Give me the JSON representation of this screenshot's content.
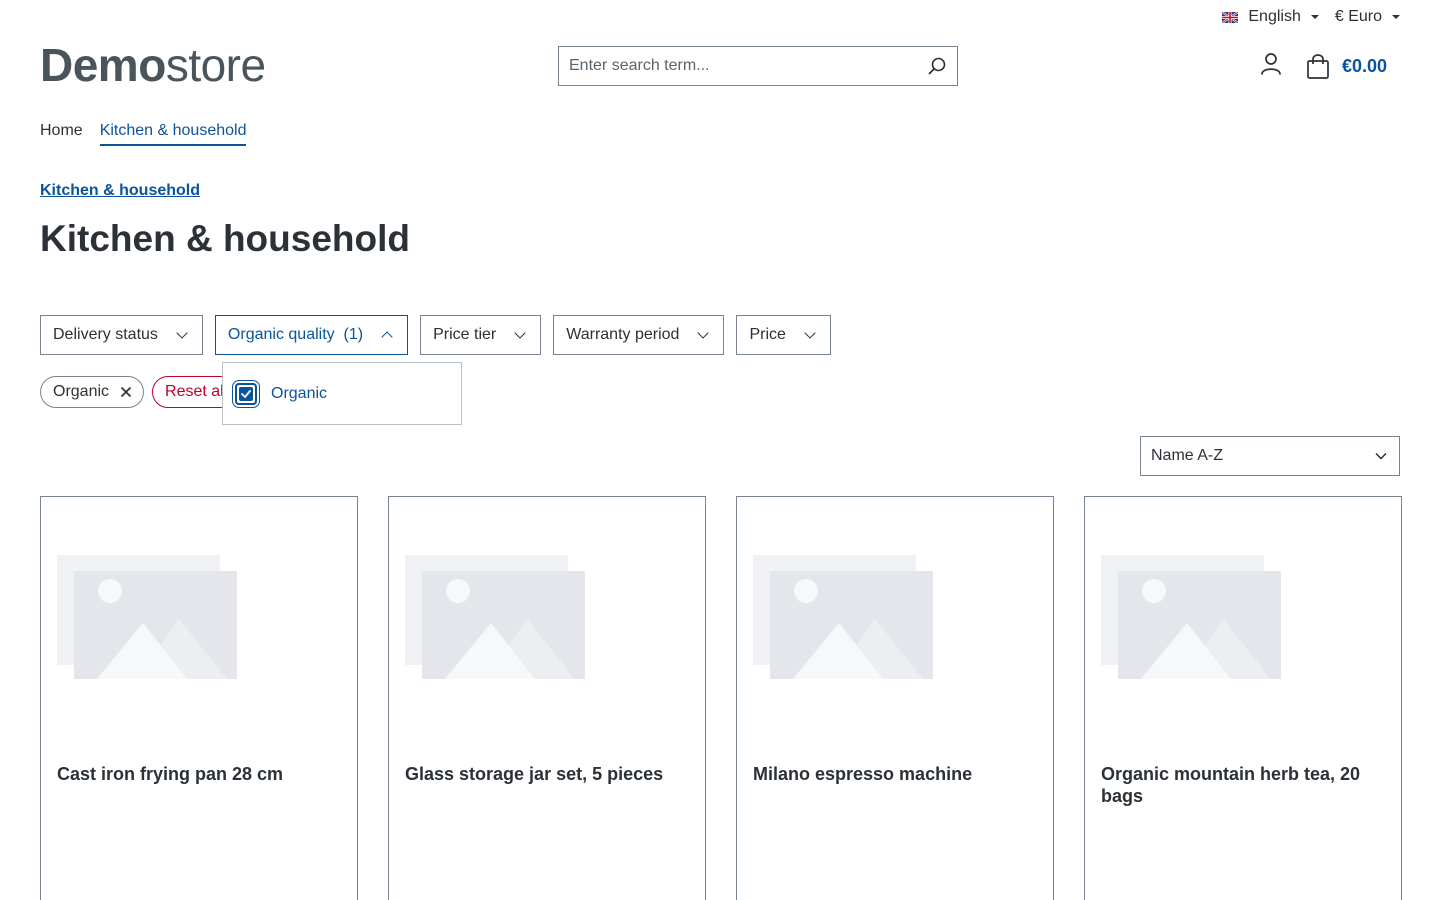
{
  "topbar": {
    "language": "English",
    "currency": "€ Euro"
  },
  "logo": {
    "bold": "Demo",
    "light": "store"
  },
  "search": {
    "placeholder": "Enter search term..."
  },
  "header": {
    "cart_total": "€0.00"
  },
  "nav": {
    "items": [
      {
        "label": "Home"
      },
      {
        "label": "Kitchen & household"
      }
    ]
  },
  "breadcrumb": {
    "label": "Kitchen & household"
  },
  "page": {
    "title": "Kitchen & household"
  },
  "filters": [
    {
      "label": "Delivery status"
    },
    {
      "label": "Organic quality  (1)"
    },
    {
      "label": "Price tier"
    },
    {
      "label": "Warranty period"
    },
    {
      "label": "Price"
    }
  ],
  "active_filters": {
    "chip": "Organic",
    "reset": "Reset all"
  },
  "dropdown": {
    "option": "Organic",
    "checked": true
  },
  "sorting": {
    "selected": "Name A-Z"
  },
  "products": [
    {
      "name": "Cast iron frying pan 28 cm"
    },
    {
      "name": "Glass storage jar set, 5 pieces"
    },
    {
      "name": "Milano espresso machine"
    },
    {
      "name": "Organic mountain herb tea, 20 bags"
    }
  ],
  "colors": {
    "primary": "#0b539b",
    "danger": "#c2002b",
    "text": "#2b3136",
    "border": "#798490"
  }
}
